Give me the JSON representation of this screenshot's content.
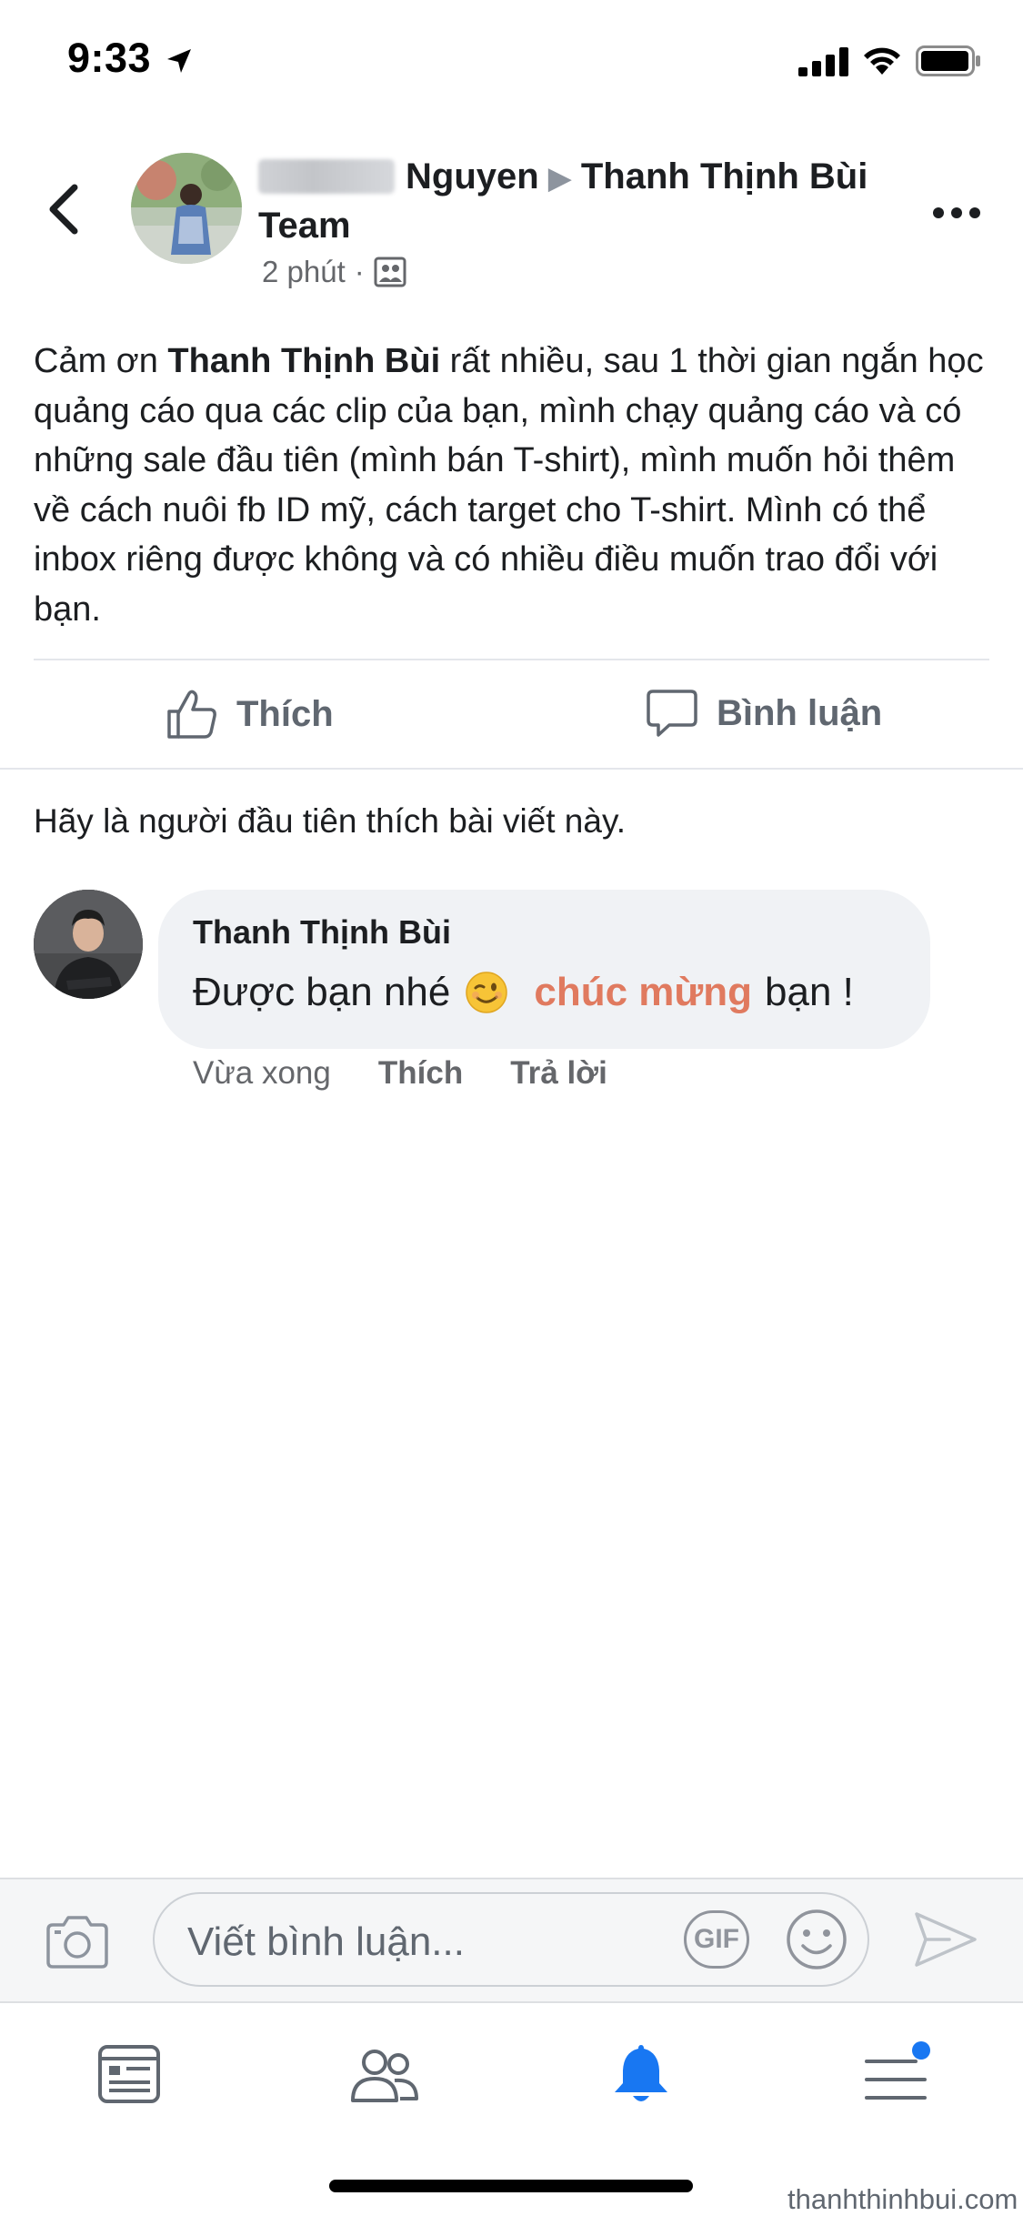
{
  "status_bar": {
    "time": "9:33"
  },
  "header": {
    "title_name_part": "Nguyen",
    "title_target": "Thanh Thịnh Bùi Team",
    "time_ago": "2 phút",
    "dot": "·"
  },
  "post": {
    "text_before": "Cảm ơn ",
    "mention": "Thanh Thịnh Bùi",
    "text_after": " rất nhiều, sau 1 thời gian ngắn học quảng cáo qua các clip của bạn, mình chạy quảng cáo và có những sale đầu tiên (mình bán T-shirt), mình muốn hỏi thêm về cách nuôi fb ID mỹ, cách target cho T-shirt. Mình có thể inbox riêng được không và có nhiều điều muốn trao đổi với bạn."
  },
  "actions": {
    "like_label": "Thích",
    "comment_label": "Bình luận"
  },
  "first_like_text": "Hãy là người đầu tiên thích bài viết này.",
  "comment": {
    "author": "Thanh Thịnh Bùi",
    "text_before": "Được bạn nhé",
    "highlight": "chúc mừng",
    "text_after": "bạn !",
    "time": "Vừa xong",
    "like_label": "Thích",
    "reply_label": "Trả lời"
  },
  "composer": {
    "placeholder": "Viết bình luận...",
    "gif_label": "GIF"
  },
  "tabs": [
    {
      "icon": "news-feed-icon",
      "active": false
    },
    {
      "icon": "friends-icon",
      "active": false
    },
    {
      "icon": "bell-icon",
      "active": true
    },
    {
      "icon": "menu-icon",
      "active": false,
      "badge": true
    }
  ],
  "watermark": "thanhthinhbui.com",
  "colors": {
    "accent_blue": "#1877f2",
    "highlight_orange": "#e07a5f",
    "muted_text": "#65676b"
  }
}
